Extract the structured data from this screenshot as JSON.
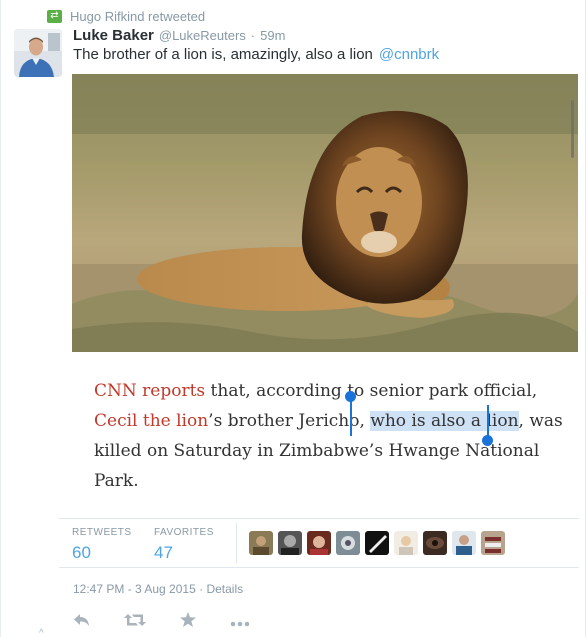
{
  "retweet": {
    "icon": "retweet-icon",
    "text": "Hugo Rifkind retweeted"
  },
  "author": {
    "fullname": "Luke Baker",
    "username": "@LukeReuters",
    "separator": "·",
    "time": "59m"
  },
  "tweet": {
    "text": "The brother of a lion is, amazingly, also a lion",
    "link": "@cnnbrk"
  },
  "quote": {
    "link1": "CNN reports",
    "t1": " that, according to",
    "t2": " senior park official,",
    "link2": "Cecil the lion",
    "t3": "’s brother Jericho, ",
    "selected": "who is also a lion",
    "t4": ", was killed on Saturday in Zimbabwe’s Hwange National Park."
  },
  "stats": {
    "retweets_label": "RETWEETS",
    "retweets_value": "60",
    "favorites_label": "FAVORITES",
    "favorites_value": "47"
  },
  "meta": {
    "datetime": "12:47 PM - 3 Aug 2015",
    "separator": "·",
    "details": "Details"
  },
  "actions": [
    "reply-icon",
    "retweet-icon",
    "favorite-icon",
    "more-icon"
  ],
  "colors": {
    "link": "#4fa4e6",
    "quote_link": "#c0392b",
    "selection": "#cfe1f5",
    "retweet_green": "#5aaf47"
  }
}
